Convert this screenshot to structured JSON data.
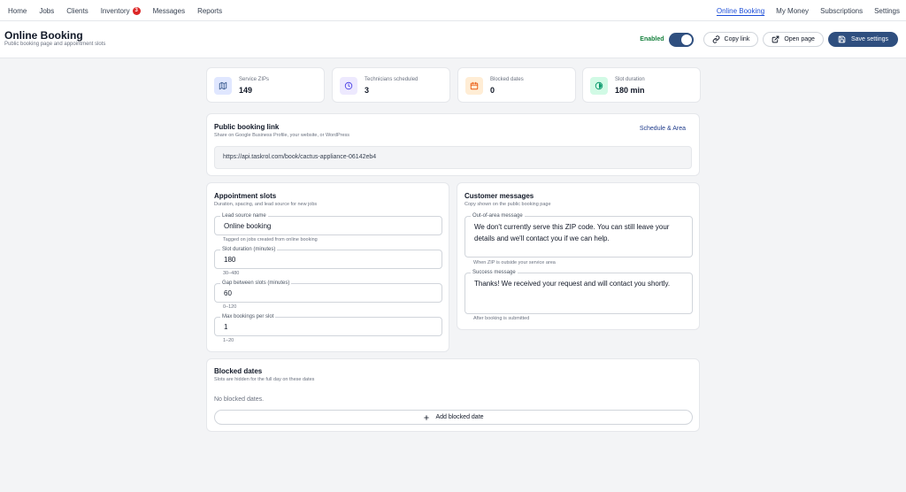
{
  "nav": {
    "left": [
      {
        "label": "Home"
      },
      {
        "label": "Jobs"
      },
      {
        "label": "Clients"
      },
      {
        "label": "Inventory",
        "badge": "3"
      },
      {
        "label": "Messages"
      },
      {
        "label": "Reports"
      }
    ],
    "right": [
      {
        "label": "Online Booking",
        "active": true
      },
      {
        "label": "My Money"
      },
      {
        "label": "Subscriptions"
      },
      {
        "label": "Settings"
      }
    ]
  },
  "header": {
    "title": "Online Booking",
    "subtitle": "Public booking page and appointment slots",
    "enabled_label": "Enabled",
    "enabled": true,
    "copy_link": "Copy link",
    "open_page": "Open page",
    "save": "Save settings"
  },
  "stats": [
    {
      "label": "Service ZIPs",
      "value": "149",
      "icon": "map-icon",
      "color": "#3b5b8f",
      "bg": "#e0e7ff"
    },
    {
      "label": "Technicians scheduled",
      "value": "3",
      "icon": "clock-icon",
      "color": "#4f46e5",
      "bg": "#ede9fe"
    },
    {
      "label": "Blocked dates",
      "value": "0",
      "icon": "calendar-icon",
      "color": "#ea580c",
      "bg": "#ffedd5"
    },
    {
      "label": "Slot duration",
      "value": "180 min",
      "icon": "timer-icon",
      "color": "#059669",
      "bg": "#d1fae5"
    }
  ],
  "booking_link": {
    "title": "Public booking link",
    "subtitle": "Share on Google Business Profile, your website, or WordPress",
    "action": "Schedule & Area",
    "url": "https://api.taskrol.com/book/cactus-appliance-06142eb4"
  },
  "slots": {
    "title": "Appointment slots",
    "subtitle": "Duration, spacing, and lead source for new jobs",
    "fields": [
      {
        "label": "Lead source name",
        "value": "Online booking",
        "helper": "Tagged on jobs created from online booking"
      },
      {
        "label": "Slot duration (minutes)",
        "value": "180",
        "helper": "30–480"
      },
      {
        "label": "Gap between slots (minutes)",
        "value": "60",
        "helper": "0–120"
      },
      {
        "label": "Max bookings per slot",
        "value": "1",
        "helper": "1–20"
      }
    ]
  },
  "messages": {
    "title": "Customer messages",
    "subtitle": "Copy shown on the public booking page",
    "fields": [
      {
        "label": "Out-of-area message",
        "value": "We don't currently serve this ZIP code. You can still leave your details and we'll contact you if we can help.",
        "helper": "When ZIP is outside your service area"
      },
      {
        "label": "Success message",
        "value": "Thanks! We received your request and will contact you shortly.",
        "helper": "After booking is submitted"
      }
    ]
  },
  "blocked": {
    "title": "Blocked dates",
    "subtitle": "Slots are hidden for the full day on these dates",
    "empty": "No blocked dates.",
    "add": "Add blocked date"
  }
}
